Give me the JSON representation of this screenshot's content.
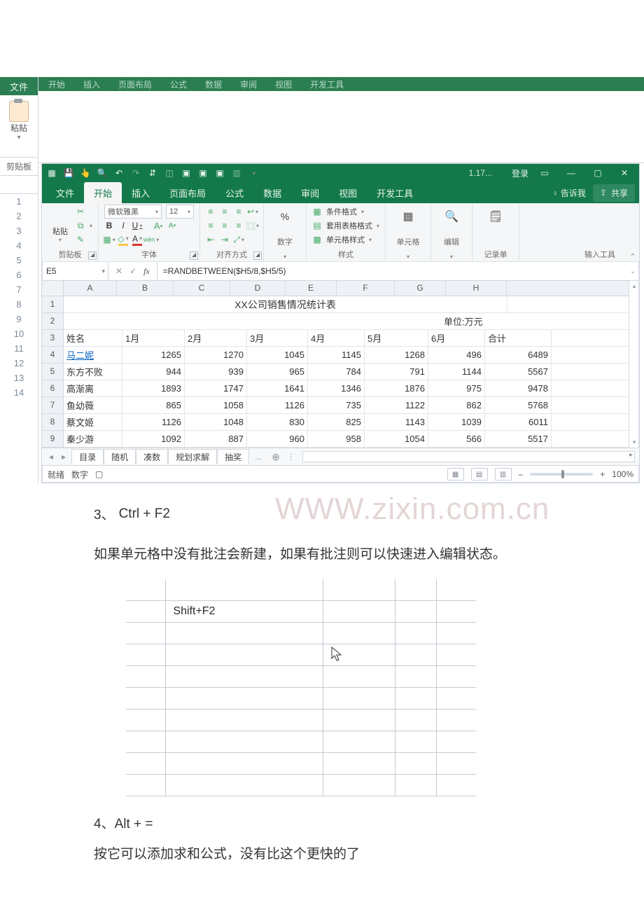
{
  "outer": {
    "row_numbers": [
      "1",
      "2",
      "3",
      "4",
      "5",
      "6",
      "7",
      "8",
      "9",
      "10",
      "11",
      "12",
      "13",
      "14"
    ],
    "topbar": {
      "items": [
        "开始",
        "插入",
        "页面布局",
        "公式",
        "数据",
        "审阅",
        "视图",
        "开发工具"
      ]
    },
    "clipboard": {
      "paste_label": "粘贴",
      "group_label": "剪贴板",
      "file_label": "文件"
    }
  },
  "excel": {
    "titlebar": {
      "filename": "1.17...",
      "login": "登录",
      "min": "—",
      "restore": "▢",
      "close": "✕"
    },
    "tabs": {
      "items": [
        "文件",
        "开始",
        "插入",
        "页面布局",
        "公式",
        "数据",
        "审阅",
        "视图",
        "开发工具"
      ],
      "active_index": 1,
      "tell_me": "告诉我",
      "share": "共享"
    },
    "ribbon": {
      "clipboard": {
        "paste": "粘贴",
        "caption": "剪贴板"
      },
      "font": {
        "name": "微软雅黑",
        "size": "12",
        "caption": "字体",
        "bold": "B",
        "italic": "I",
        "underline": "U",
        "increase": "A",
        "decrease": "A"
      },
      "alignment": {
        "caption": "对齐方式"
      },
      "number": {
        "percent": "%",
        "caption": "数字"
      },
      "styles": {
        "cond_fmt": "条件格式",
        "table_fmt": "套用表格格式",
        "cell_style": "单元格样式",
        "caption": "样式"
      },
      "cells": {
        "caption": "单元格"
      },
      "editing": {
        "caption": "编辑"
      },
      "recordform": {
        "caption": "记录单"
      },
      "inputtools": {
        "caption": "输入工具"
      }
    },
    "formula_bar": {
      "namebox": "E5",
      "cancel": "✕",
      "enter": "✓",
      "fx": "fx",
      "formula": "=RANDBETWEEN($H5/8,$H5/5)"
    },
    "columns": [
      "A",
      "B",
      "C",
      "D",
      "E",
      "F",
      "G",
      "H"
    ],
    "inner_rows": [
      "1",
      "2",
      "3",
      "4",
      "5",
      "6",
      "7",
      "8",
      "9"
    ],
    "title_row": "XX公司销售情况统计表",
    "unit_label": "单位:万元",
    "headers": [
      "姓名",
      "1月",
      "2月",
      "3月",
      "4月",
      "5月",
      "6月",
      "合计"
    ],
    "chart_data": {
      "type": "table",
      "title": "XX公司销售情况统计表",
      "unit": "万元",
      "columns": [
        "姓名",
        "1月",
        "2月",
        "3月",
        "4月",
        "5月",
        "6月",
        "合计"
      ],
      "rows": [
        {
          "name": "马二妮",
          "m1": 1265,
          "m2": 1270,
          "m3": 1045,
          "m4": 1145,
          "m5": 1268,
          "m6": 496,
          "total": 6489
        },
        {
          "name": "东方不败",
          "m1": 944,
          "m2": 939,
          "m3": 965,
          "m4": 784,
          "m5": 791,
          "m6": 1144,
          "total": 5567
        },
        {
          "name": "高渐离",
          "m1": 1893,
          "m2": 1747,
          "m3": 1641,
          "m4": 1346,
          "m5": 1876,
          "m6": 975,
          "total": 9478
        },
        {
          "name": "鱼幼薇",
          "m1": 865,
          "m2": 1058,
          "m3": 1126,
          "m4": 735,
          "m5": 1122,
          "m6": 862,
          "total": 5768
        },
        {
          "name": "蔡文姬",
          "m1": 1126,
          "m2": 1048,
          "m3": 830,
          "m4": 825,
          "m5": 1143,
          "m6": 1039,
          "total": 6011
        },
        {
          "name": "秦少游",
          "m1": 1092,
          "m2": 887,
          "m3": 960,
          "m4": 958,
          "m5": 1054,
          "m6": 566,
          "total": 5517
        }
      ]
    },
    "sheet_tabs": {
      "items": [
        "目录",
        "随机",
        "凑数",
        "规划求解",
        "抽奖"
      ],
      "more": "...",
      "add": "⊕"
    },
    "status": {
      "ready": "就绪",
      "mode": "数字",
      "zoom": "100%",
      "plus": "+"
    }
  },
  "sections": {
    "three_label_num": "3、",
    "three_label_key": "Ctrl + F2",
    "three_text": "如果单元格中没有批注会新建，如果有批注则可以快速进入编辑状态。",
    "shift_f2": "Shift+F2",
    "four_label": "4、Alt + =",
    "four_text": "按它可以添加求和公式，没有比这个更快的了"
  },
  "watermark": "WWW.zixin.com.cn"
}
